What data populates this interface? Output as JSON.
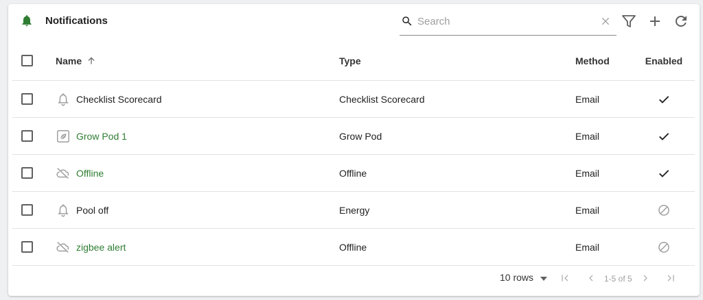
{
  "header": {
    "title": "Notifications",
    "title_icon": "bell-icon",
    "accent_color": "#2e7d32"
  },
  "search": {
    "placeholder": "Search",
    "value": ""
  },
  "toolbar": {
    "icons": [
      "filter-icon",
      "add-icon",
      "refresh-icon"
    ]
  },
  "table": {
    "columns": {
      "name": "Name",
      "type": "Type",
      "method": "Method",
      "enabled": "Enabled"
    },
    "sort": {
      "column": "Name",
      "direction": "ascending"
    },
    "rows": [
      {
        "icon": "bell-outline-icon",
        "name": "Checklist Scorecard",
        "name_is_link": false,
        "type": "Checklist Scorecard",
        "method": "Email",
        "enabled": true
      },
      {
        "icon": "leaf-square-icon",
        "name": "Grow Pod 1",
        "name_is_link": true,
        "type": "Grow Pod",
        "method": "Email",
        "enabled": true
      },
      {
        "icon": "cloud-off-icon",
        "name": "Offline",
        "name_is_link": true,
        "type": "Offline",
        "method": "Email",
        "enabled": true
      },
      {
        "icon": "bell-outline-icon",
        "name": "Pool off",
        "name_is_link": false,
        "type": "Energy",
        "method": "Email",
        "enabled": false
      },
      {
        "icon": "cloud-off-icon",
        "name": "zigbee alert",
        "name_is_link": true,
        "type": "Offline",
        "method": "Email",
        "enabled": false
      }
    ]
  },
  "pagination": {
    "rows_per_page": "10 rows",
    "range": "1-5 of 5"
  }
}
